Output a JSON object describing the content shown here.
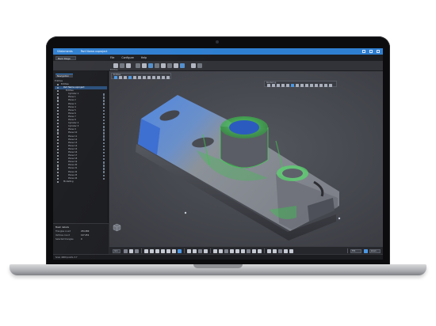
{
  "window": {
    "app_name": "VXelements",
    "doc_title": "Part Name.vxproject",
    "accent_color": "#2f7fd1"
  },
  "menu": {
    "backstage_label": "Back Stage",
    "items": [
      "File",
      "Configure",
      "Help"
    ]
  },
  "ribbon": {
    "group_label": "Entities"
  },
  "sidebar": {
    "tab_label": "Navigation",
    "header": "Entities",
    "tree": [
      {
        "label": "Entities",
        "level": 0,
        "selected": false
      },
      {
        "label": "Part Name.vxproject",
        "level": 1,
        "selected": true
      },
      {
        "label": "Entities",
        "level": 2,
        "selected": false
      },
      {
        "label": "Cylinder 1",
        "level": 3,
        "selected": false
      },
      {
        "label": "Plane 1",
        "level": 3,
        "selected": false
      },
      {
        "label": "Plane 2",
        "level": 3,
        "selected": false
      },
      {
        "label": "Plane 3",
        "level": 3,
        "selected": false
      },
      {
        "label": "Plane 4",
        "level": 3,
        "selected": false
      },
      {
        "label": "Plane 5",
        "level": 3,
        "selected": false
      },
      {
        "label": "Plane 6",
        "level": 3,
        "selected": false
      },
      {
        "label": "Plane 7",
        "level": 3,
        "selected": false
      },
      {
        "label": "Plane 8",
        "level": 3,
        "selected": false
      },
      {
        "label": "Cylinder 2",
        "level": 3,
        "selected": false
      },
      {
        "label": "Cylinder 3",
        "level": 3,
        "selected": false
      },
      {
        "label": "Plane 9",
        "level": 3,
        "selected": false
      },
      {
        "label": "Plane 10",
        "level": 3,
        "selected": false
      },
      {
        "label": "Plane 11",
        "level": 3,
        "selected": false
      },
      {
        "label": "Plane 12",
        "level": 3,
        "selected": false
      },
      {
        "label": "Plane 13",
        "level": 3,
        "selected": false
      },
      {
        "label": "Plane 14",
        "level": 3,
        "selected": false
      },
      {
        "label": "Plane 15",
        "level": 3,
        "selected": false
      },
      {
        "label": "Plane 16",
        "level": 3,
        "selected": false
      },
      {
        "label": "Plane 17",
        "level": 3,
        "selected": false
      },
      {
        "label": "Plane 18",
        "level": 3,
        "selected": false
      },
      {
        "label": "Plane 19",
        "level": 3,
        "selected": false
      },
      {
        "label": "Plane 20",
        "level": 3,
        "selected": false
      },
      {
        "label": "Plane 21",
        "level": 3,
        "selected": false
      },
      {
        "label": "Plane 22",
        "level": 3,
        "selected": false
      },
      {
        "label": "Plane 23",
        "level": 3,
        "selected": false
      },
      {
        "label": "Plane 24",
        "level": 3,
        "selected": false
      },
      {
        "label": "Modelling",
        "level": 1,
        "selected": false
      }
    ]
  },
  "properties": {
    "title": "Mesh details",
    "rows": [
      {
        "label": "Triangles count",
        "value": "254,380"
      },
      {
        "label": "Vertices count",
        "value": "127,251"
      },
      {
        "label": "Selected triangles",
        "value": "0"
      }
    ]
  },
  "viewport": {
    "toolbar_left_label": "Entities",
    "toolbar_right_label": "Rendering",
    "mesh_color_primary": "#3f6fc4",
    "mesh_color_secondary": "#3cbf4a"
  },
  "status": {
    "text": "Scan 4000 points 3.7",
    "fps_label": "FPS",
    "zoom_label": "Zoom"
  }
}
